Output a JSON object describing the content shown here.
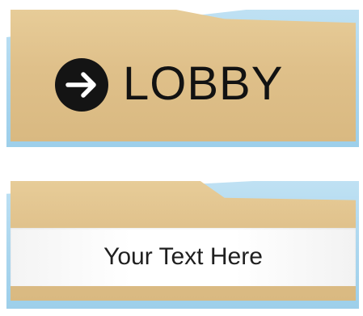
{
  "signs": [
    {
      "icon": "arrow-right-circle-icon",
      "label": "LOBBY"
    },
    {
      "label": "Your Text Here"
    }
  ],
  "colors": {
    "gold": "#dfc08a",
    "blue": "#a9d5ee",
    "white": "#ffffff",
    "text": "#121212"
  }
}
